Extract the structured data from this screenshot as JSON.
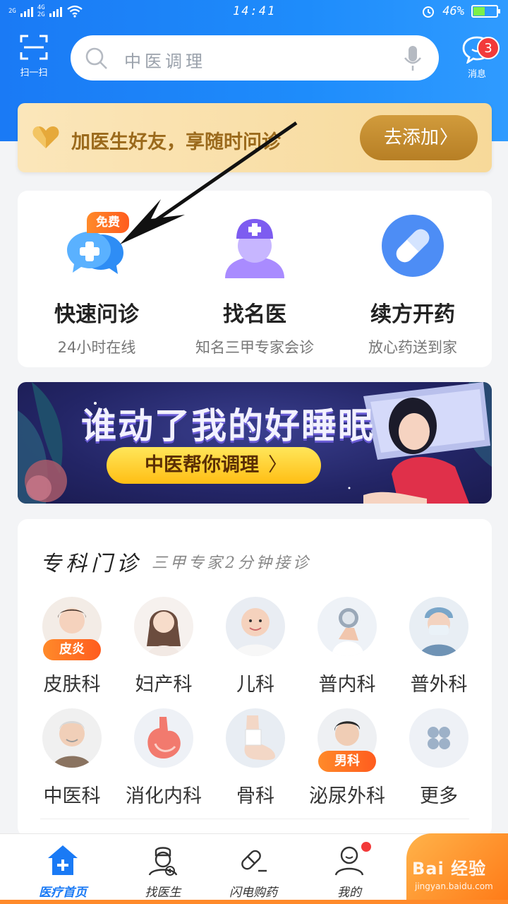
{
  "status_bar": {
    "network": [
      "2G",
      "4G",
      "2G",
      "2G"
    ],
    "time": "14:41",
    "battery": "46%"
  },
  "header": {
    "scan_label": "扫一扫",
    "search_placeholder": "中医调理",
    "message_label": "消息",
    "message_badge": "3"
  },
  "friend_banner": {
    "text": "加医生好友，享随时问诊",
    "button": "去添加",
    "button_chevron": "〉"
  },
  "services": [
    {
      "title": "快速问诊",
      "subtitle": "24小时在线",
      "tag": "免费",
      "icon": "chat-plus-icon"
    },
    {
      "title": "找名医",
      "subtitle": "知名三甲专家会诊",
      "icon": "nurse-icon"
    },
    {
      "title": "续方开药",
      "subtitle": "放心药送到家",
      "icon": "pill-icon"
    }
  ],
  "promo_banner": {
    "headline": "谁动了我的好睡眠",
    "cta": "中医帮你调理",
    "cta_chevron": "〉"
  },
  "clinics": {
    "title": "专科门诊",
    "subtitle": "三甲专家2分钟接诊",
    "departments": [
      {
        "label": "皮肤科",
        "tag": "皮炎"
      },
      {
        "label": "妇产科"
      },
      {
        "label": "儿科"
      },
      {
        "label": "普内科"
      },
      {
        "label": "普外科"
      },
      {
        "label": "中医科"
      },
      {
        "label": "消化内科"
      },
      {
        "label": "骨科"
      },
      {
        "label": "泌尿外科",
        "tag": "男科"
      },
      {
        "label": "更多"
      }
    ]
  },
  "tabbar": {
    "tabs": [
      {
        "label": "医疗首页",
        "active": true
      },
      {
        "label": "找医生"
      },
      {
        "label": "闪电购药"
      },
      {
        "label": "我的"
      }
    ],
    "watermark_line1": "Bai 经验",
    "watermark_line2": "jingyan.baidu.com"
  },
  "colors": {
    "primary": "#1a7af5",
    "accent_orange": "#ff7a17",
    "gold": "#b77f25",
    "badge_red": "#f23a3a"
  }
}
